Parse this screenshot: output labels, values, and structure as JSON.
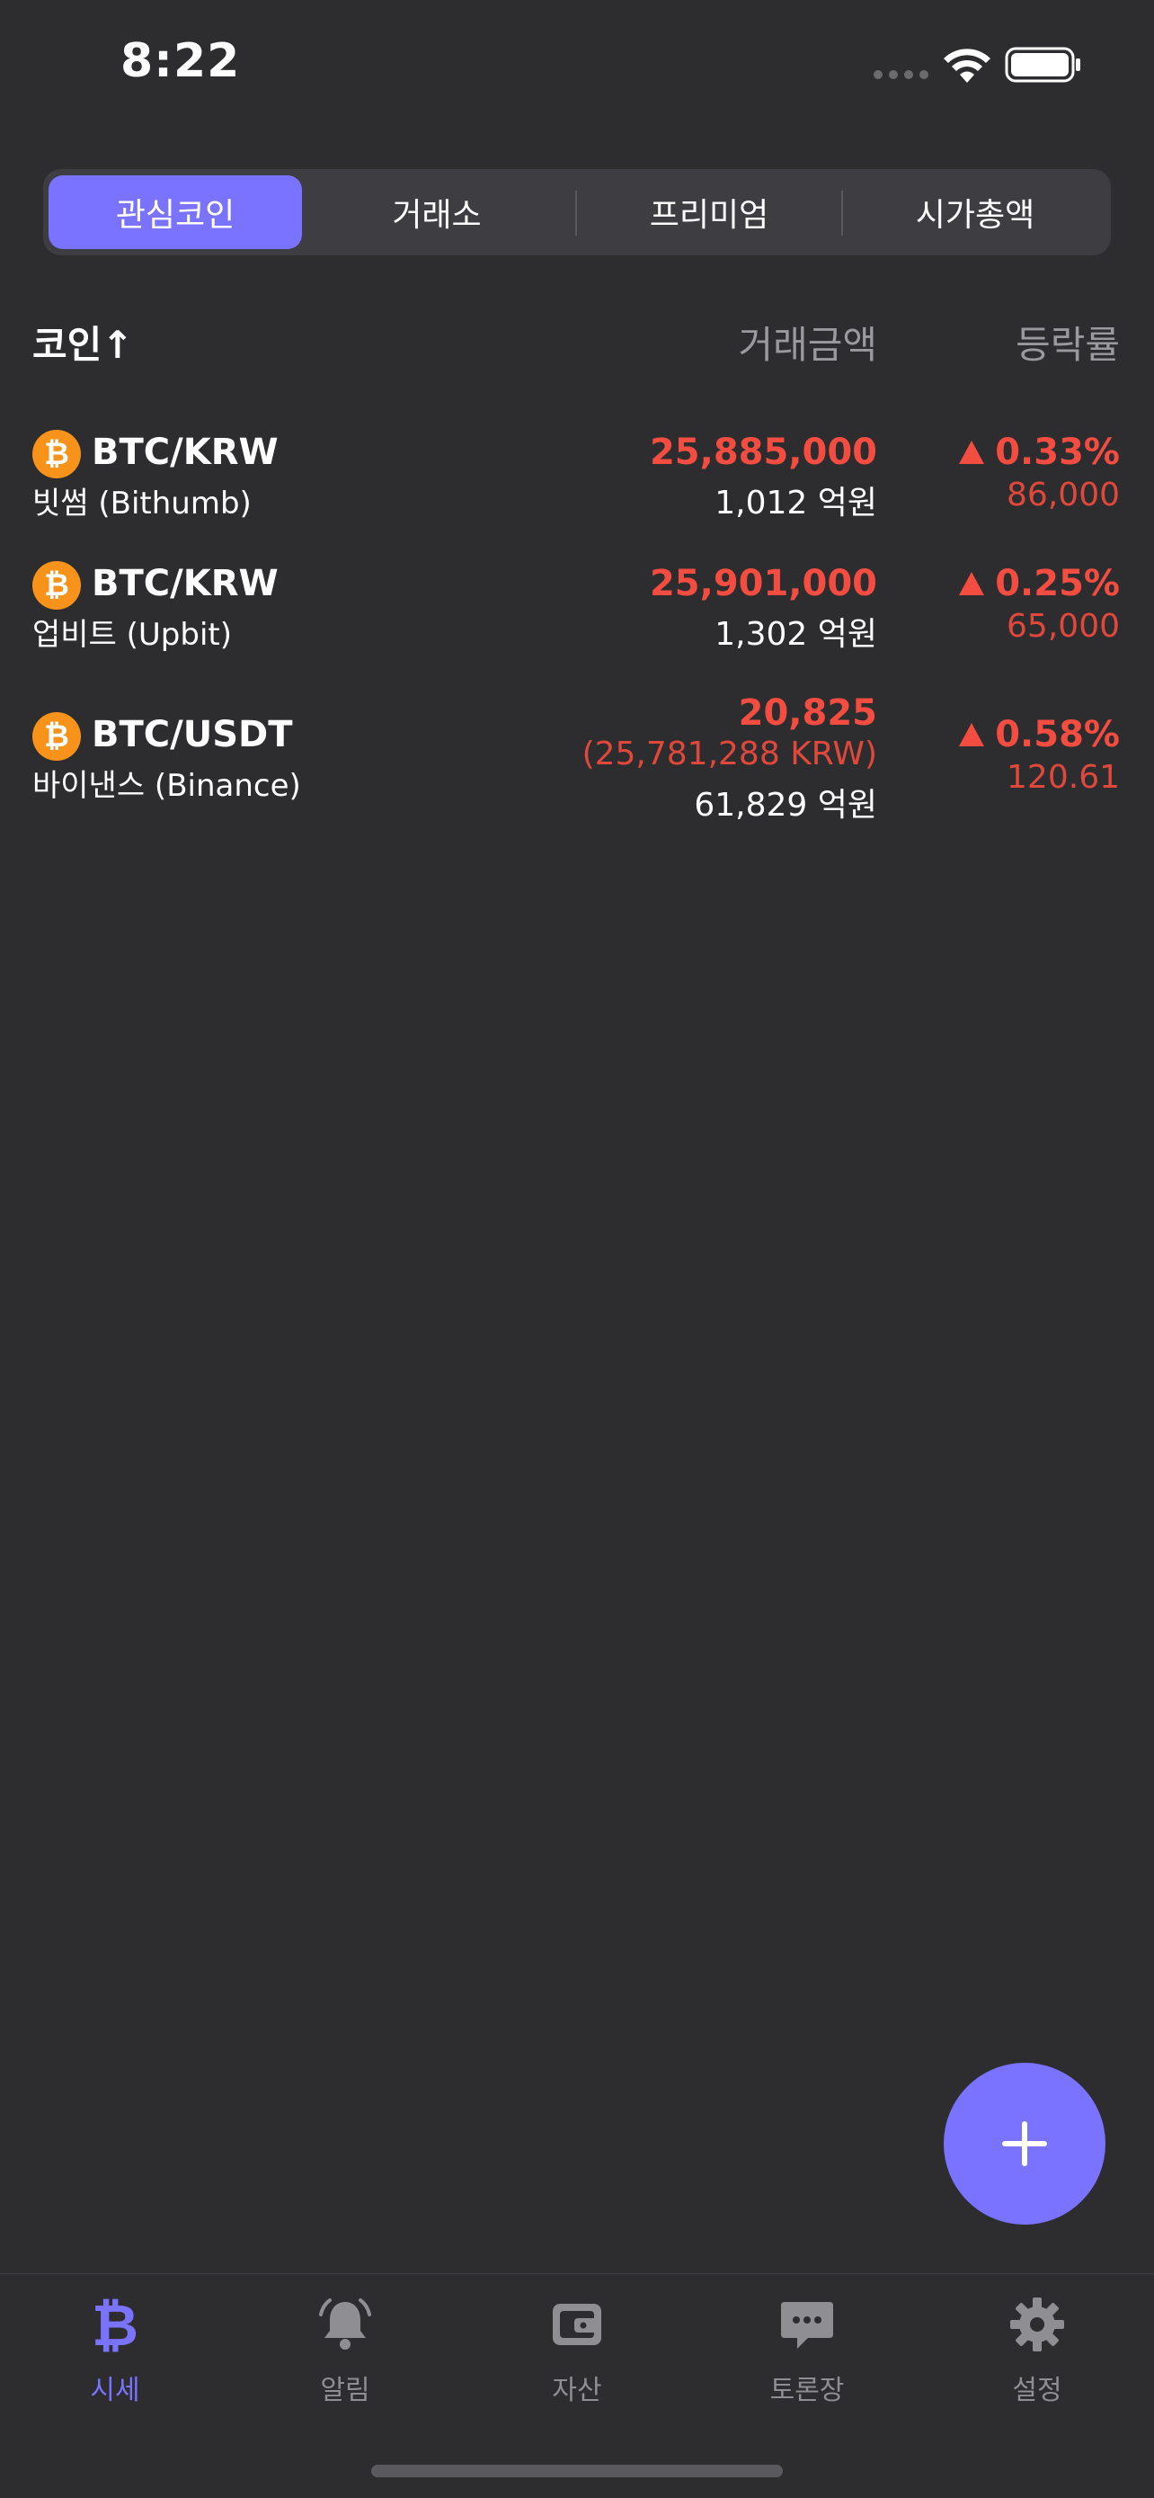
{
  "status_bar": {
    "time": "8:22"
  },
  "segments": [
    {
      "label": "관심코인",
      "active": true
    },
    {
      "label": "거래소",
      "active": false
    },
    {
      "label": "프리미엄",
      "active": false
    },
    {
      "label": "시가총액",
      "active": false
    }
  ],
  "table_header": {
    "coin": "코인↑",
    "amount": "거래금액",
    "change": "등락률"
  },
  "rows": [
    {
      "logo": "₿",
      "pair": "BTC/KRW",
      "exchange": "빗썸 (Bithumb)",
      "price": "25,885,000",
      "volume": "1,012 억원",
      "change_pct": "0.33%",
      "change_amt": "86,000"
    },
    {
      "logo": "₿",
      "pair": "BTC/KRW",
      "exchange": "업비트 (Upbit)",
      "price": "25,901,000",
      "volume": "1,302 억원",
      "change_pct": "0.25%",
      "change_amt": "65,000"
    },
    {
      "logo": "₿",
      "pair": "BTC/USDT",
      "exchange": "바이낸스 (Binance)",
      "price": "20,825",
      "converted_price": "(25,781,288 KRW)",
      "volume": "61,829 억원",
      "change_pct": "0.58%",
      "change_amt": "120.61"
    }
  ],
  "tabs": [
    {
      "label": "시세",
      "icon": "bitcoin-icon",
      "active": true
    },
    {
      "label": "알림",
      "icon": "bell-icon",
      "active": false
    },
    {
      "label": "자산",
      "icon": "wallet-icon",
      "active": false
    },
    {
      "label": "토론장",
      "icon": "chat-bubble-icon",
      "active": false
    },
    {
      "label": "설정",
      "icon": "gear-icon",
      "active": false
    }
  ],
  "colors": {
    "accent": "#7a73ff",
    "up": "#f24d40",
    "background": "#2d2d2f",
    "bitcoin": "#f7931a"
  }
}
